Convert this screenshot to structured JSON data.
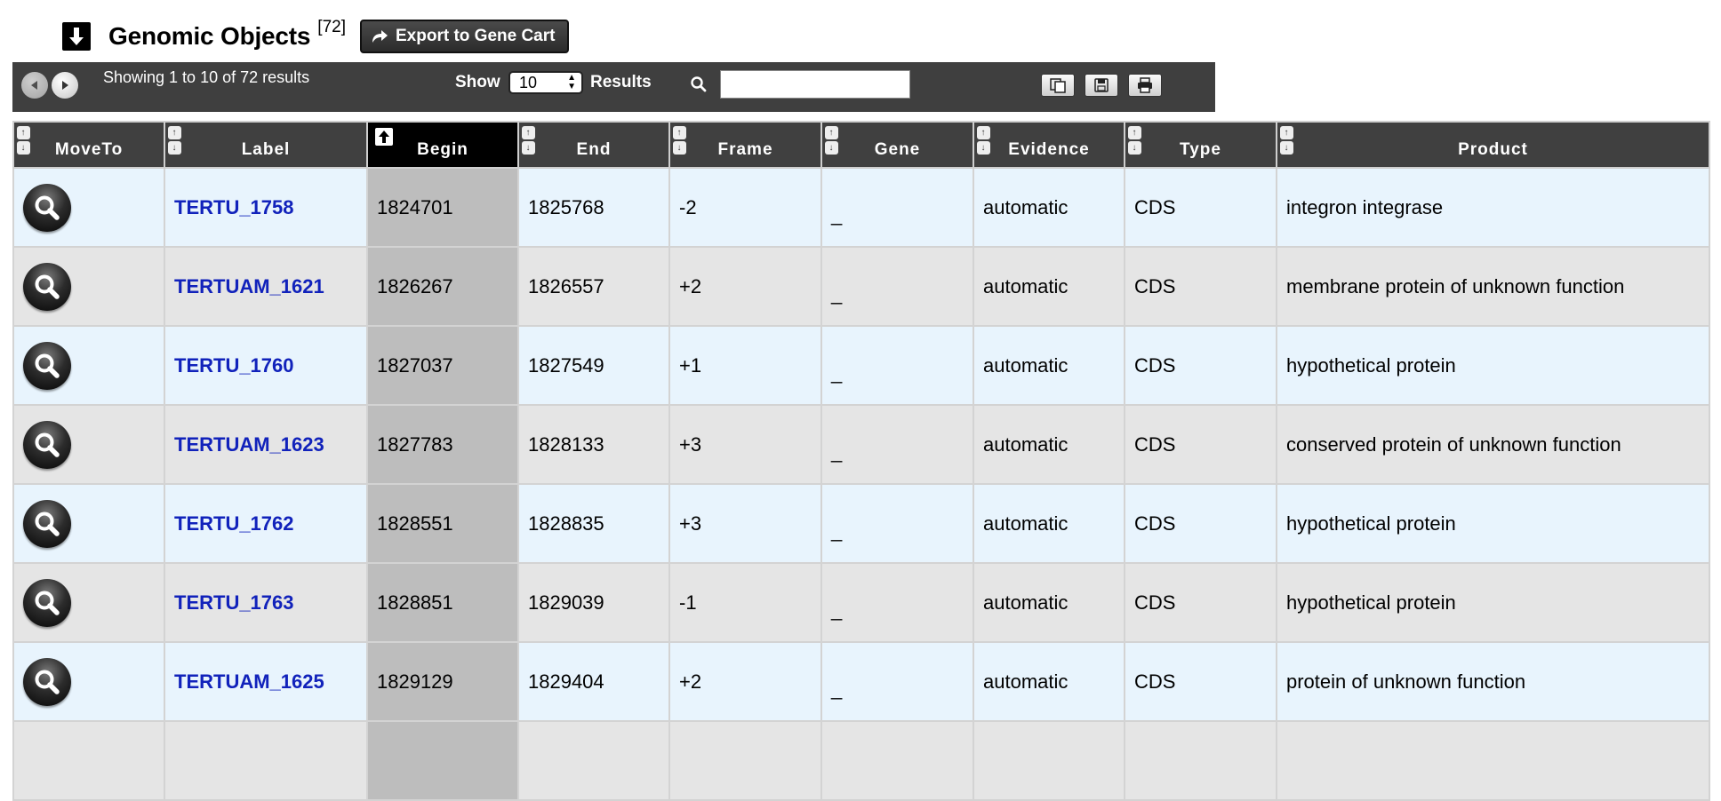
{
  "section": {
    "title": "Genomic Objects",
    "count": "[72]",
    "export_label": "Export to Gene Cart"
  },
  "toolbar": {
    "showing": "Showing 1 to 10 of 72 results",
    "show_label": "Show",
    "page_size": "10",
    "results_label": "Results",
    "search_value": ""
  },
  "columns": [
    "MoveTo",
    "Label",
    "Begin",
    "End",
    "Frame",
    "Gene",
    "Evidence",
    "Type",
    "Product"
  ],
  "rows": [
    {
      "label": "TERTU_1758",
      "begin": "1824701",
      "end": "1825768",
      "frame": "-2",
      "gene": "_",
      "evidence": "automatic",
      "type": "CDS",
      "product": "integron integrase"
    },
    {
      "label": "TERTUAM_1621",
      "begin": "1826267",
      "end": "1826557",
      "frame": "+2",
      "gene": "_",
      "evidence": "automatic",
      "type": "CDS",
      "product": "membrane protein of unknown function"
    },
    {
      "label": "TERTU_1760",
      "begin": "1827037",
      "end": "1827549",
      "frame": "+1",
      "gene": "_",
      "evidence": "automatic",
      "type": "CDS",
      "product": "hypothetical protein"
    },
    {
      "label": "TERTUAM_1623",
      "begin": "1827783",
      "end": "1828133",
      "frame": "+3",
      "gene": "_",
      "evidence": "automatic",
      "type": "CDS",
      "product": "conserved protein of unknown function"
    },
    {
      "label": "TERTU_1762",
      "begin": "1828551",
      "end": "1828835",
      "frame": "+3",
      "gene": "_",
      "evidence": "automatic",
      "type": "CDS",
      "product": "hypothetical protein"
    },
    {
      "label": "TERTU_1763",
      "begin": "1828851",
      "end": "1829039",
      "frame": "-1",
      "gene": "_",
      "evidence": "automatic",
      "type": "CDS",
      "product": "hypothetical protein"
    },
    {
      "label": "TERTUAM_1625",
      "begin": "1829129",
      "end": "1829404",
      "frame": "+2",
      "gene": "_",
      "evidence": "automatic",
      "type": "CDS",
      "product": "protein of unknown function"
    },
    {
      "label": "",
      "begin": "",
      "end": "",
      "frame": "",
      "gene": "",
      "evidence": "",
      "type": "",
      "product": ""
    }
  ],
  "colors": {
    "toolbar_bg": "#3f3f3f",
    "header_bg": "#404040",
    "sorted_header_bg": "#000000",
    "row_odd": "#e8f4fd",
    "row_even": "#e5e5e5",
    "sorted_column_bg": "#bdbdbd",
    "link": "#1122bb"
  },
  "icons": {
    "collapse": "arrow-down-icon",
    "export": "share-arrow-icon",
    "prev": "prev-page-icon",
    "next": "next-page-icon",
    "search": "search-icon",
    "copy": "copy-icon",
    "save": "save-icon",
    "print": "print-icon",
    "moveto": "magnifier-icon"
  }
}
